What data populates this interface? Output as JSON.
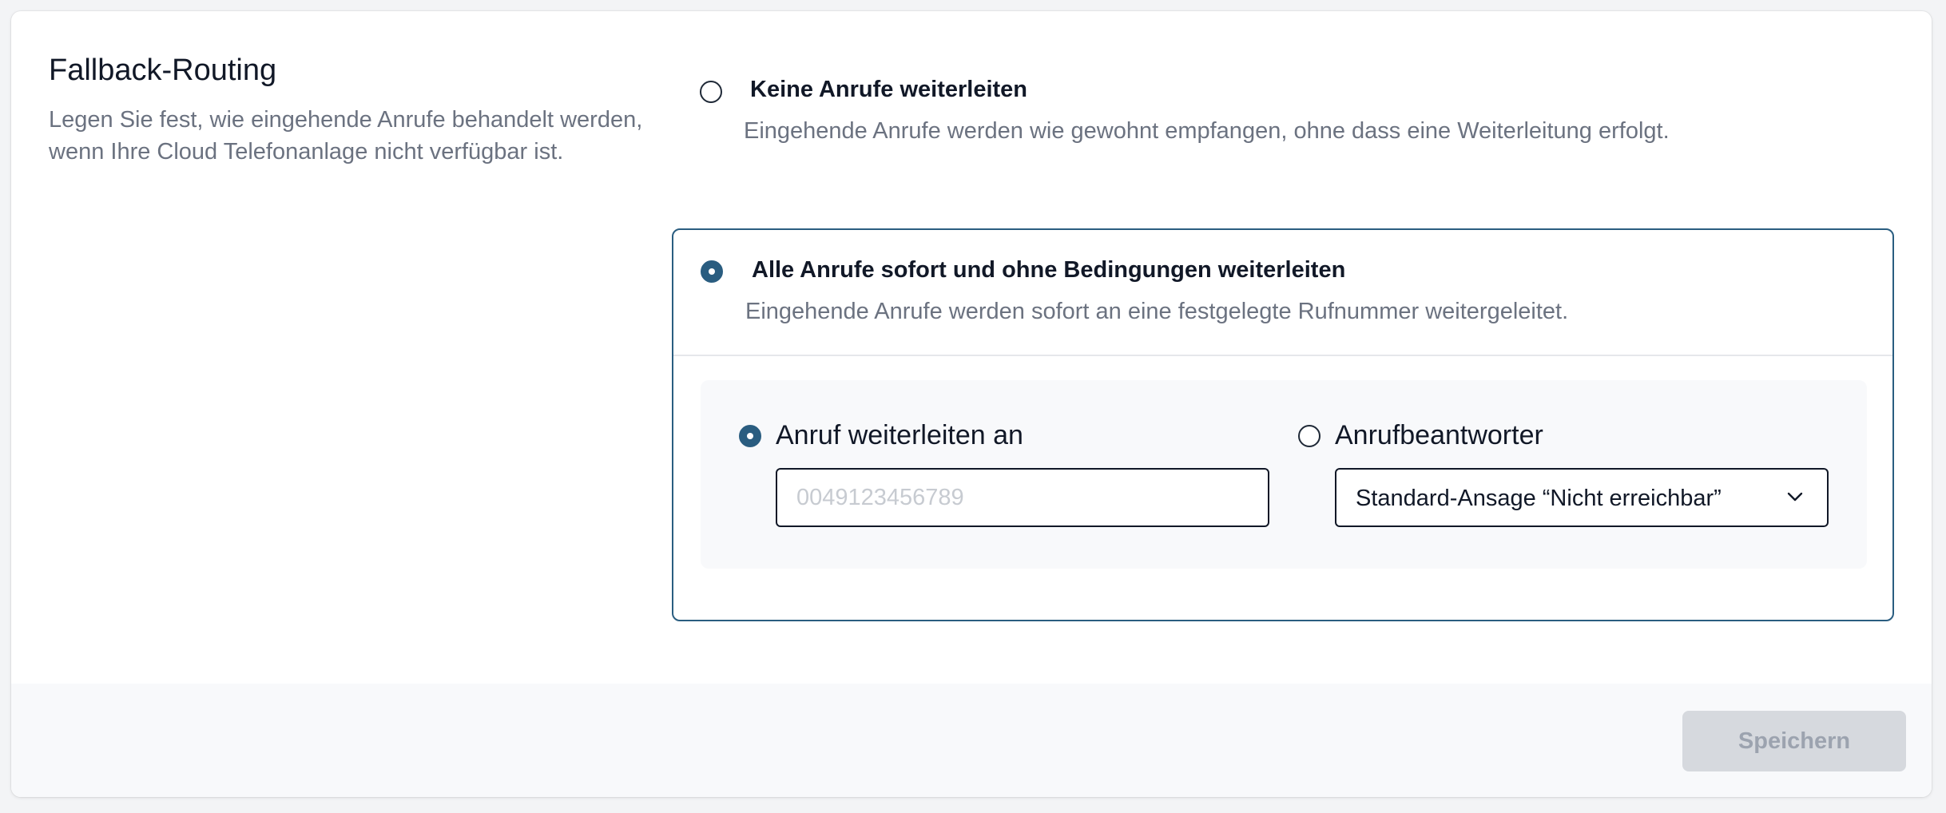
{
  "section": {
    "title": "Fallback-Routing",
    "description": "Legen Sie fest, wie eingehende Anrufe behandelt werden, wenn Ihre Cloud Telefonanlage nicht verfügbar ist."
  },
  "options": [
    {
      "title": "Keine Anrufe weiterleiten",
      "description": "Eingehende Anrufe werden wie gewohnt empfangen, ohne dass eine Weiterleitung erfolgt.",
      "selected": false
    },
    {
      "title": "Alle Anrufe sofort und ohne Bedingungen weiterleiten",
      "description": "Eingehende Anrufe werden sofort an eine festgelegte Rufnummer weitergeleitet.",
      "selected": true
    }
  ],
  "forward": {
    "label": "Anruf weiterleiten an",
    "selected": true,
    "placeholder": "0049123456789",
    "value": ""
  },
  "voicemail": {
    "label": "Anrufbeantworter",
    "selected": false,
    "select_value": "Standard-Ansage “Nicht erreichbar”"
  },
  "footer": {
    "save_label": "Speichern"
  },
  "colors": {
    "accent": "#2a5d80",
    "muted_text": "#6b7280",
    "disabled_button_bg": "#d6d9de",
    "disabled_button_text": "#9ca3af"
  },
  "icons": {
    "select_arrow": "chevron-down-icon"
  }
}
